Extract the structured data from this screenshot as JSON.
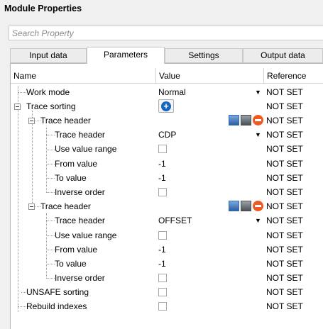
{
  "window": {
    "title": "Module Properties"
  },
  "search": {
    "placeholder": "Search Property"
  },
  "tabs": [
    {
      "label": "Input data",
      "active": false
    },
    {
      "label": "Parameters",
      "active": true
    },
    {
      "label": "Settings",
      "active": false
    },
    {
      "label": "Output data",
      "active": false
    }
  ],
  "columns": {
    "name": "Name",
    "value": "Value",
    "reference": "Reference"
  },
  "rows": [
    {
      "name": "Work mode",
      "value": "Normal",
      "reference": "NOT SET"
    },
    {
      "name": "Trace sorting",
      "value": "",
      "reference": "NOT SET"
    },
    {
      "name": "Trace header",
      "value": "",
      "reference": "NOT SET"
    },
    {
      "name": "Trace header",
      "value": "CDP",
      "reference": "NOT SET"
    },
    {
      "name": "Use value range",
      "value": "",
      "reference": "NOT SET"
    },
    {
      "name": "From value",
      "value": "-1",
      "reference": "NOT SET"
    },
    {
      "name": "To value",
      "value": "-1",
      "reference": "NOT SET"
    },
    {
      "name": "Inverse order",
      "value": "",
      "reference": "NOT SET"
    },
    {
      "name": "Trace header",
      "value": "",
      "reference": "NOT SET"
    },
    {
      "name": "Trace header",
      "value": "OFFSET",
      "reference": "NOT SET"
    },
    {
      "name": "Use value range",
      "value": "",
      "reference": "NOT SET"
    },
    {
      "name": "From value",
      "value": "-1",
      "reference": "NOT SET"
    },
    {
      "name": "To value",
      "value": "-1",
      "reference": "NOT SET"
    },
    {
      "name": "Inverse order",
      "value": "",
      "reference": "NOT SET"
    },
    {
      "name": "UNSAFE sorting",
      "value": "",
      "reference": "NOT SET"
    },
    {
      "name": "Rebuild indexes",
      "value": "",
      "reference": "NOT SET"
    }
  ],
  "icons": {
    "add": "add-circle-icon",
    "move": "move-header-icon",
    "copy": "copy-header-icon",
    "remove": "remove-circle-icon",
    "dropdown": "dropdown-arrow-icon",
    "dropdown_glyph": "▼",
    "add_glyph": "+"
  },
  "colors": {
    "accent": "#1565c0",
    "remove": "#f05a22"
  }
}
